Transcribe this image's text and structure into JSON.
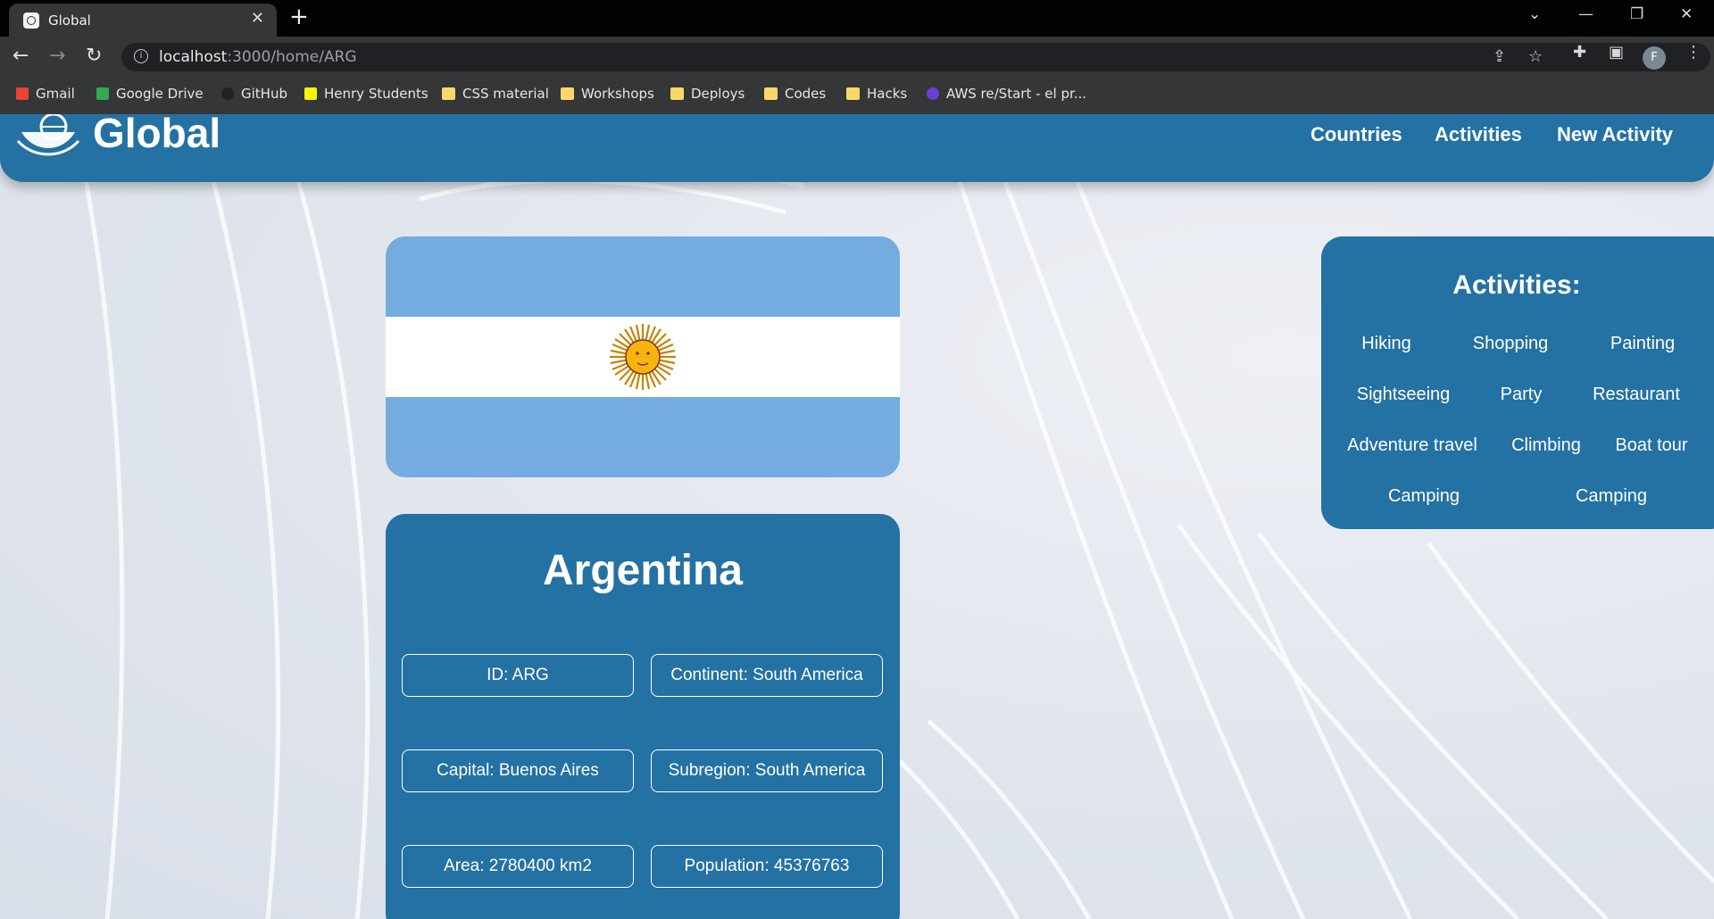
{
  "browser": {
    "tab_title": "Global",
    "new_tab": "+",
    "url_host": "localhost",
    "url_path": ":3000/home/ARG",
    "profile_initial": "F",
    "bookmarks": [
      {
        "label": "Gmail",
        "icon": "gmail-icon",
        "color": "#ea4335"
      },
      {
        "label": "Google Drive",
        "icon": "google-drive-icon",
        "color": "#34a853"
      },
      {
        "label": "GitHub",
        "icon": "github-icon",
        "color": "#202124"
      },
      {
        "label": "Henry Students",
        "icon": "henry-icon",
        "color": "#f5f500"
      },
      {
        "label": "CSS material",
        "icon": "folder-icon",
        "color": "#f9d86a"
      },
      {
        "label": "Workshops",
        "icon": "folder-icon",
        "color": "#f9d86a"
      },
      {
        "label": "Deploys",
        "icon": "folder-icon",
        "color": "#f9d86a"
      },
      {
        "label": "Codes",
        "icon": "folder-icon",
        "color": "#f9d86a"
      },
      {
        "label": "Hacks",
        "icon": "folder-icon",
        "color": "#f9d86a"
      },
      {
        "label": "AWS re/Start - el pr...",
        "icon": "aws-icon",
        "color": "#6b3fd1"
      }
    ]
  },
  "header": {
    "logo_text": "Global",
    "nav": [
      "Countries",
      "Activities",
      "New Activity"
    ]
  },
  "country": {
    "name": "Argentina",
    "fields": [
      "ID: ARG",
      "Continent: South America",
      "Capital: Buenos Aires",
      "Subregion: South America",
      "Area: 2780400 km2",
      "Population: 45376763"
    ],
    "flag_colors": {
      "blue": "#74acdf",
      "white": "#ffffff",
      "sun": "#f6b40e"
    }
  },
  "activities": {
    "title": "Activities:",
    "items": [
      "Hiking",
      "Shopping",
      "Painting",
      "Sightseeing",
      "Party",
      "Restaurant",
      "Adventure travel",
      "Climbing",
      "Boat tour",
      "Camping",
      "Camping"
    ]
  },
  "colors": {
    "accent": "#2471a3",
    "chrome": "#353638"
  }
}
